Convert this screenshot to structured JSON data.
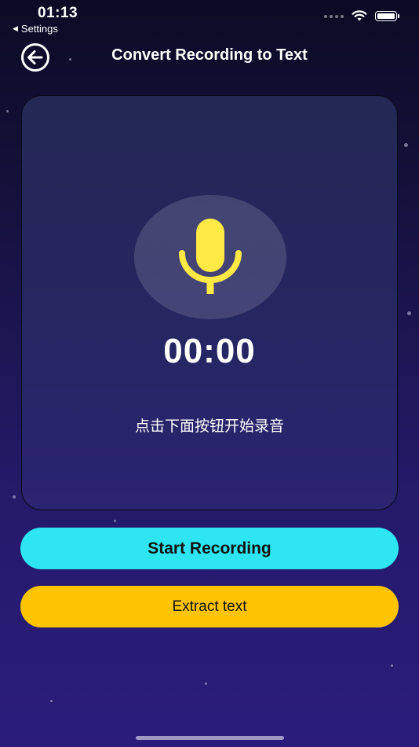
{
  "status_bar": {
    "time": "01:13",
    "back_app_label": "Settings"
  },
  "nav": {
    "title": "Convert Recording to Text"
  },
  "recorder": {
    "timer": "00:00",
    "hint": "点击下面按钮开始录音"
  },
  "buttons": {
    "start_recording": "Start Recording",
    "extract_text": "Extract text"
  },
  "colors": {
    "start_button": "#2ee6f2",
    "extract_button": "#ffc400",
    "mic_icon": "#ffea45"
  }
}
